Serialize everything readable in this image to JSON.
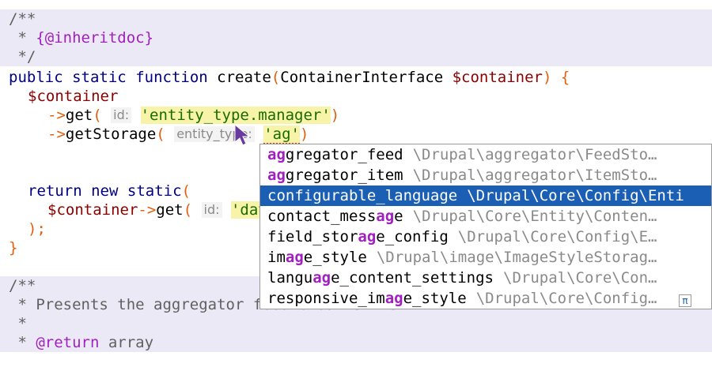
{
  "editor": {
    "lines": {
      "l1": "/**",
      "l2_star": " * ",
      "l2_tag": "{@inheritdoc}",
      "l3": " */",
      "l4_kw1": "public",
      "l4_kw2": "static",
      "l4_kw3": "function",
      "l4_fn": "create",
      "l4_paren_open": "(",
      "l4_type": "ContainerInterface",
      "l4_var": "$container",
      "l4_paren_close": ")",
      "l4_brace": "{",
      "l5_var": "$container",
      "l6_arrow": "->",
      "l6_fn": "get",
      "l6_paren_open": "(",
      "l6_hint": "id:",
      "l6_str": "'entity_type.manager'",
      "l6_paren_close": ")",
      "l7_arrow": "->",
      "l7_fn": "getStorage",
      "l7_paren_open": "(",
      "l7_hint": "entity_type:",
      "l7_str": "'ag'",
      "l7_paren_close": ")",
      "l9_kw1": "return",
      "l9_kw2": "new",
      "l9_kw3": "static",
      "l9_paren": "(",
      "l10_var": "$container",
      "l10_arrow": "->",
      "l10_fn": "get",
      "l10_paren": "(",
      "l10_hint": "id:",
      "l10_str": "'dat",
      "l11": ");",
      "l12": "}",
      "l14": "/**",
      "l15": " * Presents the aggregator feed creation form.",
      "l16": " *",
      "l17_star": " * ",
      "l17_tag": "@return",
      "l17_type": " array"
    }
  },
  "completion": {
    "items": [
      {
        "pre": "",
        "match": "ag",
        "post": "gregator_feed",
        "path": "\\Drupal\\aggregator\\FeedSto…"
      },
      {
        "pre": "",
        "match": "ag",
        "post": "gregator_item",
        "path": "\\Drupal\\aggregator\\ItemSto…"
      },
      {
        "pre": "configurable_language",
        "match": "",
        "post": "",
        "path": "\\Drupal\\Core\\Config\\Enti"
      },
      {
        "pre": "contact_mess",
        "match": "ag",
        "post": "e",
        "path": "\\Drupal\\Core\\Entity\\Conten…"
      },
      {
        "pre": "field_stor",
        "match": "ag",
        "post": "e_config",
        "path": "\\Drupal\\Core\\Config\\E…"
      },
      {
        "pre": "im",
        "match": "ag",
        "post": "e_style",
        "path": "\\Drupal\\image\\ImageStyleStorag…"
      },
      {
        "pre": "langu",
        "match": "ag",
        "post": "e_content_settings",
        "path": "\\Drupal\\Core\\Con…"
      },
      {
        "pre": "responsive_im",
        "match": "ag",
        "post": "e_style",
        "path": "\\Drupal\\Core\\Config…"
      }
    ],
    "selected_index": 2,
    "footer_icon": "π"
  },
  "colors": {
    "doc_background": "#ece9f6",
    "selection": "#1a5fb4",
    "match": "#a020c0",
    "string_bg": "#f7f3a8"
  }
}
